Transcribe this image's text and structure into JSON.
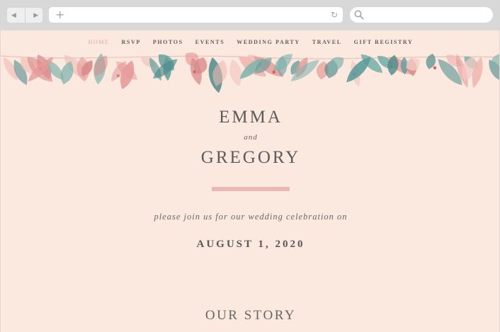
{
  "browser": {
    "back_glyph": "◀",
    "forward_glyph": "▶",
    "new_tab_glyph": "+",
    "reload_glyph": "↻"
  },
  "nav": {
    "items": [
      {
        "label": "HOME",
        "active": true
      },
      {
        "label": "RSVP",
        "active": false
      },
      {
        "label": "PHOTOS",
        "active": false
      },
      {
        "label": "EVENTS",
        "active": false
      },
      {
        "label": "WEDDING PARTY",
        "active": false
      },
      {
        "label": "TRAVEL",
        "active": false
      },
      {
        "label": "GIFT REGISTRY",
        "active": false
      }
    ]
  },
  "hero": {
    "name1": "EMMA",
    "and": "and",
    "name2": "GREGORY",
    "invite": "please join us for our wedding celebration on",
    "date": "AUGUST 1, 2020"
  },
  "section": {
    "story_title": "OUR STORY"
  },
  "colors": {
    "page_bg": "#fbe8df",
    "accent_pink": "#e9b7b4",
    "leaf_teal": "#5f9c9a",
    "leaf_pink": "#e59a98",
    "text": "#5b5b5b"
  }
}
